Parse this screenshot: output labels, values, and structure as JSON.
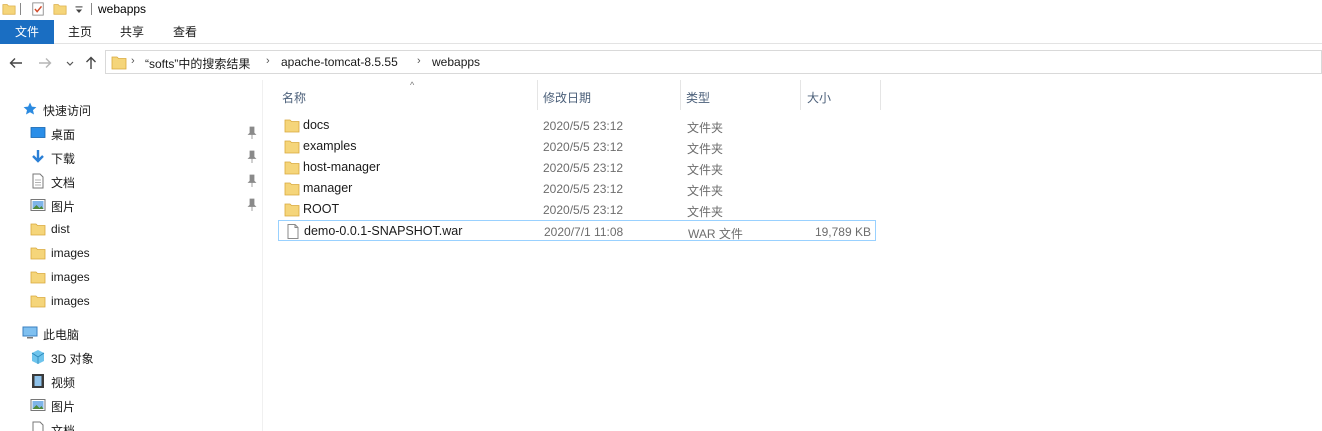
{
  "window": {
    "title": "webapps"
  },
  "ribbon": {
    "tabs": [
      {
        "label": "文件"
      },
      {
        "label": "主页"
      },
      {
        "label": "共享"
      },
      {
        "label": "查看"
      }
    ]
  },
  "address": {
    "breadcrumbs": [
      "“softs”中的搜索结果",
      "apache-tomcat-8.5.55",
      "webapps"
    ],
    "separator": "›"
  },
  "nav": {
    "quick_access": "快速访问",
    "pinned": [
      {
        "label": "桌面",
        "icon": "desktop-icon"
      },
      {
        "label": "下载",
        "icon": "download-icon"
      },
      {
        "label": "文档",
        "icon": "documents-icon"
      },
      {
        "label": "图片",
        "icon": "pictures-icon"
      }
    ],
    "recent": [
      {
        "label": "dist"
      },
      {
        "label": "images"
      },
      {
        "label": "images"
      },
      {
        "label": "images"
      }
    ],
    "this_pc": "此电脑",
    "pc_items": [
      {
        "label": "3D 对象",
        "icon": "3d-objects-icon"
      },
      {
        "label": "视频",
        "icon": "videos-icon"
      },
      {
        "label": "图片",
        "icon": "pictures-icon"
      },
      {
        "label": "文档",
        "icon": "documents-icon"
      }
    ]
  },
  "columns": {
    "name": "名称",
    "date": "修改日期",
    "type": "类型",
    "size": "大小"
  },
  "files": [
    {
      "name": "docs",
      "date": "2020/5/5 23:12",
      "type": "文件夹",
      "size": "",
      "kind": "folder"
    },
    {
      "name": "examples",
      "date": "2020/5/5 23:12",
      "type": "文件夹",
      "size": "",
      "kind": "folder"
    },
    {
      "name": "host-manager",
      "date": "2020/5/5 23:12",
      "type": "文件夹",
      "size": "",
      "kind": "folder"
    },
    {
      "name": "manager",
      "date": "2020/5/5 23:12",
      "type": "文件夹",
      "size": "",
      "kind": "folder"
    },
    {
      "name": "ROOT",
      "date": "2020/5/5 23:12",
      "type": "文件夹",
      "size": "",
      "kind": "folder"
    },
    {
      "name": "demo-0.0.1-SNAPSHOT.war",
      "date": "2020/7/1 11:08",
      "type": "WAR 文件",
      "size": "19,789 KB",
      "kind": "file"
    }
  ],
  "colors": {
    "accent": "#1a6ec2",
    "folder": "#f5d57a",
    "selection_border": "#99d1ff"
  }
}
